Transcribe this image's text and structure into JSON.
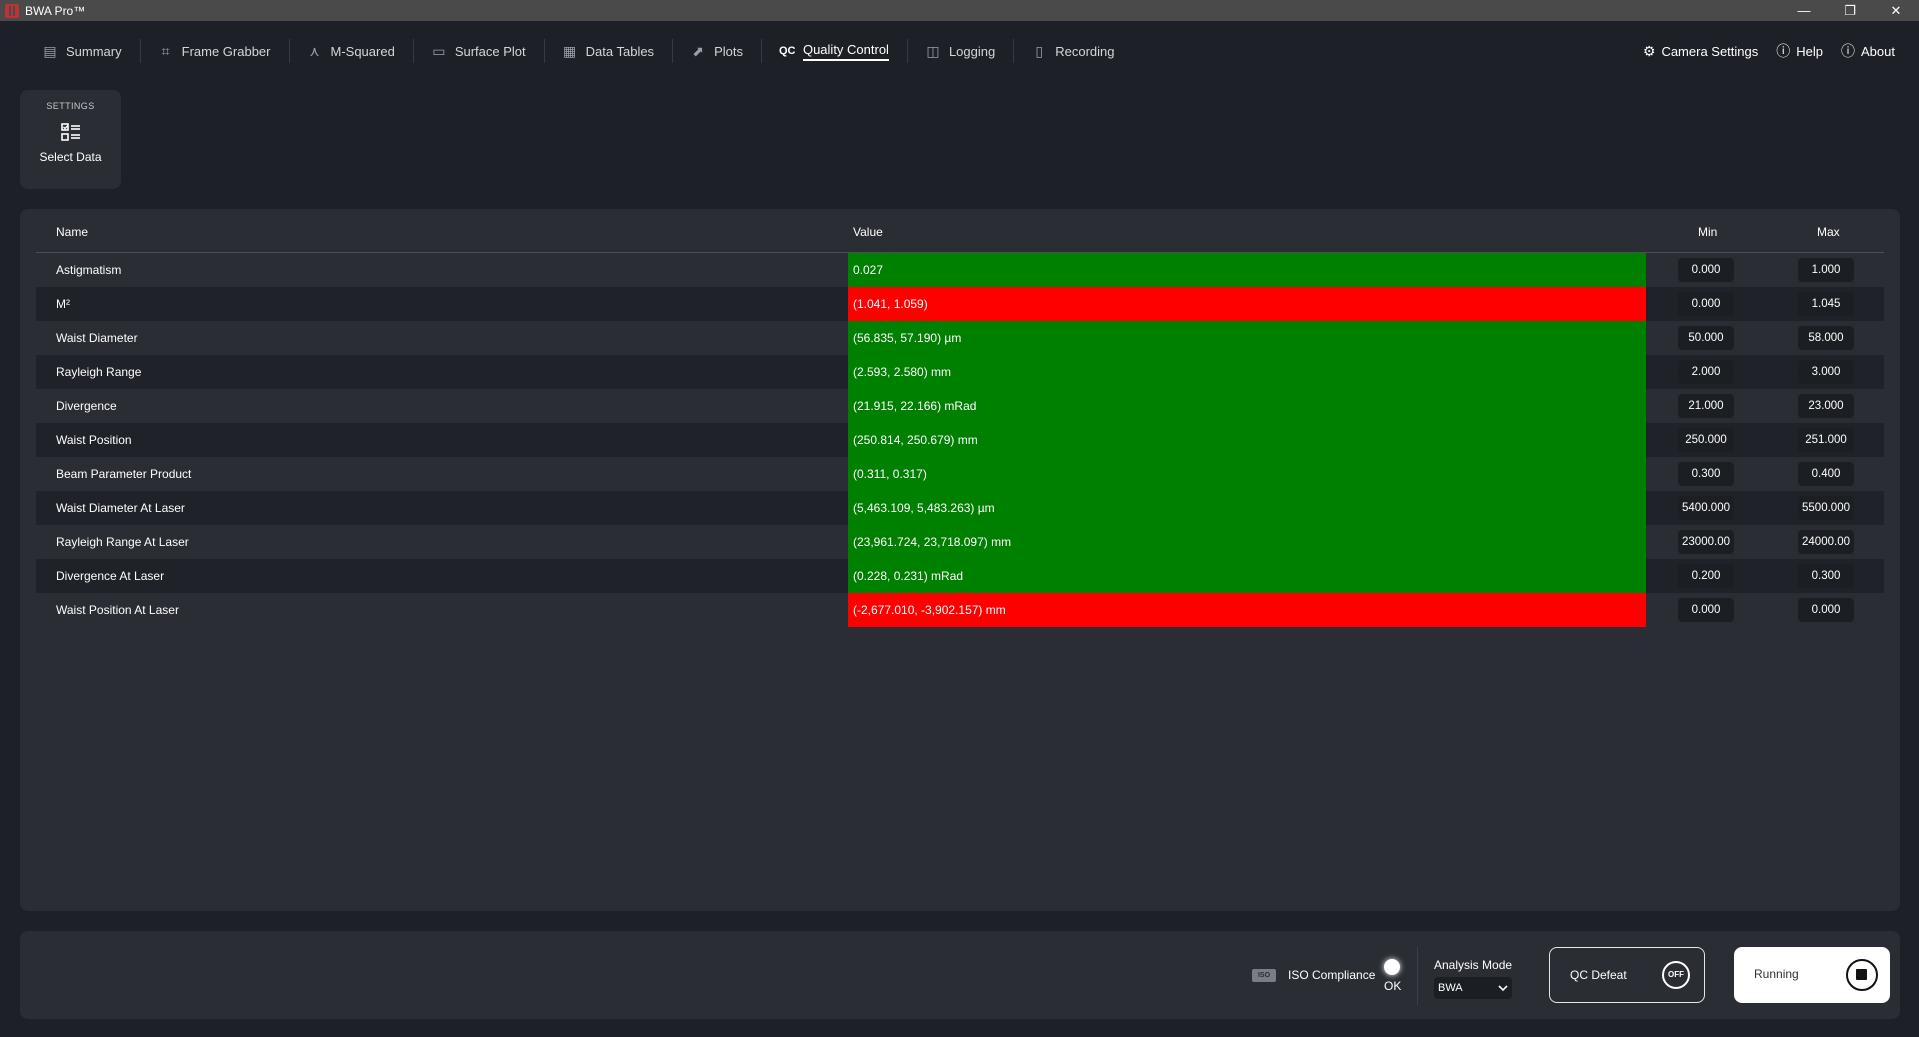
{
  "window": {
    "title": "BWA Pro™",
    "controls": [
      "—",
      "❐",
      "✕"
    ]
  },
  "nav": {
    "tabs": [
      {
        "label": "Summary",
        "icon": "summary-icon",
        "glyph": "▤"
      },
      {
        "label": "Frame Grabber",
        "icon": "frame-grabber-icon",
        "glyph": "⌗"
      },
      {
        "label": "M-Squared",
        "icon": "m-squared-icon",
        "glyph": "⋏"
      },
      {
        "label": "Surface Plot",
        "icon": "surface-plot-icon",
        "glyph": "▭"
      },
      {
        "label": "Data Tables",
        "icon": "data-tables-icon",
        "glyph": "▦"
      },
      {
        "label": "Plots",
        "icon": "plots-icon",
        "glyph": "⬈"
      },
      {
        "label": "Quality Control",
        "icon": "qc-icon",
        "glyph": "QC"
      },
      {
        "label": "Logging",
        "icon": "logging-icon",
        "glyph": "◫"
      },
      {
        "label": "Recording",
        "icon": "recording-icon",
        "glyph": "▯"
      }
    ],
    "active_tab": "Quality Control",
    "right": {
      "camera_settings": "Camera Settings",
      "help": "Help",
      "about": "About"
    }
  },
  "settings": {
    "section_label": "SETTINGS",
    "select_data_label": "Select Data"
  },
  "table": {
    "headers": {
      "name": "Name",
      "value": "Value",
      "min": "Min",
      "max": "Max"
    },
    "rows": [
      {
        "name": "Astigmatism",
        "value": "0.027",
        "status": "pass",
        "min": "0.000",
        "max": "1.000"
      },
      {
        "name": "M²",
        "value": "(1.041, 1.059)",
        "status": "fail",
        "min": "0.000",
        "max": "1.045"
      },
      {
        "name": "Waist Diameter",
        "value": "(56.835, 57.190) µm",
        "status": "pass",
        "min": "50.000",
        "max": "58.000"
      },
      {
        "name": "Rayleigh Range",
        "value": "(2.593, 2.580) mm",
        "status": "pass",
        "min": "2.000",
        "max": "3.000"
      },
      {
        "name": "Divergence",
        "value": "(21.915, 22.166) mRad",
        "status": "pass",
        "min": "21.000",
        "max": "23.000"
      },
      {
        "name": "Waist Position",
        "value": "(250.814, 250.679) mm",
        "status": "pass",
        "min": "250.000",
        "max": "251.000"
      },
      {
        "name": "Beam Parameter Product",
        "value": "(0.311, 0.317)",
        "status": "pass",
        "min": "0.300",
        "max": "0.400"
      },
      {
        "name": "Waist Diameter At Laser",
        "value": "(5,463.109, 5,483.263) µm",
        "status": "pass",
        "min": "5400.000",
        "max": "5500.000"
      },
      {
        "name": "Rayleigh Range At Laser",
        "value": "(23,961.724, 23,718.097) mm",
        "status": "pass",
        "min": "23000.00",
        "max": "24000.00"
      },
      {
        "name": "Divergence At Laser",
        "value": "(0.228, 0.231) mRad",
        "status": "pass",
        "min": "0.200",
        "max": "0.300"
      },
      {
        "name": "Waist Position At Laser",
        "value": "(-2,677.010, -3,902.157) mm",
        "status": "fail",
        "min": "0.000",
        "max": "0.000"
      }
    ]
  },
  "bottom": {
    "iso_badge": "ISO",
    "iso_label": "ISO Compliance",
    "iso_status": "OK",
    "analysis_mode_label": "Analysis Mode",
    "analysis_mode_value": "BWA",
    "qc_defeat_label": "QC Defeat",
    "qc_defeat_state": "OFF",
    "running_label": "Running"
  },
  "colors": {
    "pass": "#008000",
    "fail": "#ff0000",
    "background": "#1d2026",
    "panel": "#2a2d33"
  }
}
